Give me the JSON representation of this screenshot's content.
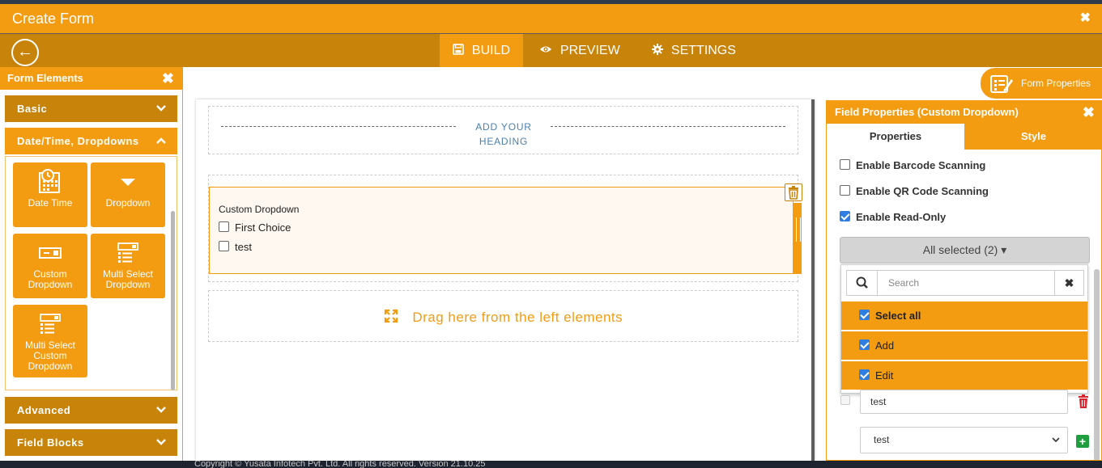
{
  "background": {
    "footer_text": "Copyright © Yusata Infotech Pvt. Ltd. All rights reserved.   Version 21.10.25"
  },
  "titlebar": {
    "title": "Create Form",
    "close_glyph": "✖"
  },
  "navbar": {
    "back_glyph": "←",
    "tabs": [
      {
        "label": "BUILD",
        "icon": "save-icon",
        "active": true
      },
      {
        "label": "PREVIEW",
        "icon": "eye-icon",
        "active": false
      },
      {
        "label": "SETTINGS",
        "icon": "gear-icon",
        "active": false
      }
    ]
  },
  "form_elements": {
    "title": "Form Elements",
    "close_glyph": "✖",
    "sections": [
      {
        "label": "Basic",
        "open": false
      },
      {
        "label": "Date/Time, Dropdowns",
        "open": true
      },
      {
        "label": "Advanced",
        "open": false
      },
      {
        "label": "Field Blocks",
        "open": false
      }
    ],
    "tiles": [
      {
        "label": "Date Time",
        "icon": "calendar-clock-icon"
      },
      {
        "label": "Dropdown",
        "icon": "caret-down-icon"
      },
      {
        "label": "Custom Dropdown",
        "icon": "select-box-icon"
      },
      {
        "label": "Multi Select Dropdown",
        "icon": "multi-list-icon"
      },
      {
        "label": "Multi Select Custom Dropdown",
        "icon": "multi-list-icon"
      }
    ]
  },
  "canvas": {
    "heading_text": "ADD YOUR HEADING",
    "field": {
      "label": "Custom Dropdown",
      "options": [
        "First Choice",
        "test"
      ]
    },
    "drop_text": "Drag here from the left elements"
  },
  "form_properties_button": {
    "label": "Form Properties",
    "icon": "form-edit-icon"
  },
  "field_properties": {
    "title": "Field Properties (Custom Dropdown)",
    "close_glyph": "✖",
    "tabs": {
      "properties": "Properties",
      "style": "Style"
    },
    "options": [
      {
        "label": "Enable Barcode Scanning",
        "checked": false
      },
      {
        "label": "Enable QR Code Scanning",
        "checked": false
      },
      {
        "label": "Enable Read-Only",
        "checked": true
      }
    ],
    "multiselect": {
      "button_label": "All selected (2) ▾",
      "search_placeholder": "Search",
      "clear_glyph": "✖",
      "items": [
        {
          "label": "Select all",
          "checked": true
        },
        {
          "label": "Add",
          "checked": true
        },
        {
          "label": "Edit",
          "checked": true
        }
      ]
    },
    "option_row": {
      "value": "test"
    },
    "select_value": "test",
    "select_caret": "⌄",
    "plus_glyph": "+"
  },
  "colors": {
    "primary": "#f39c12",
    "dark": "#c8830a",
    "heading_blue": "#4a7fb0",
    "danger": "#d9232d",
    "success": "#1e9e3f"
  }
}
